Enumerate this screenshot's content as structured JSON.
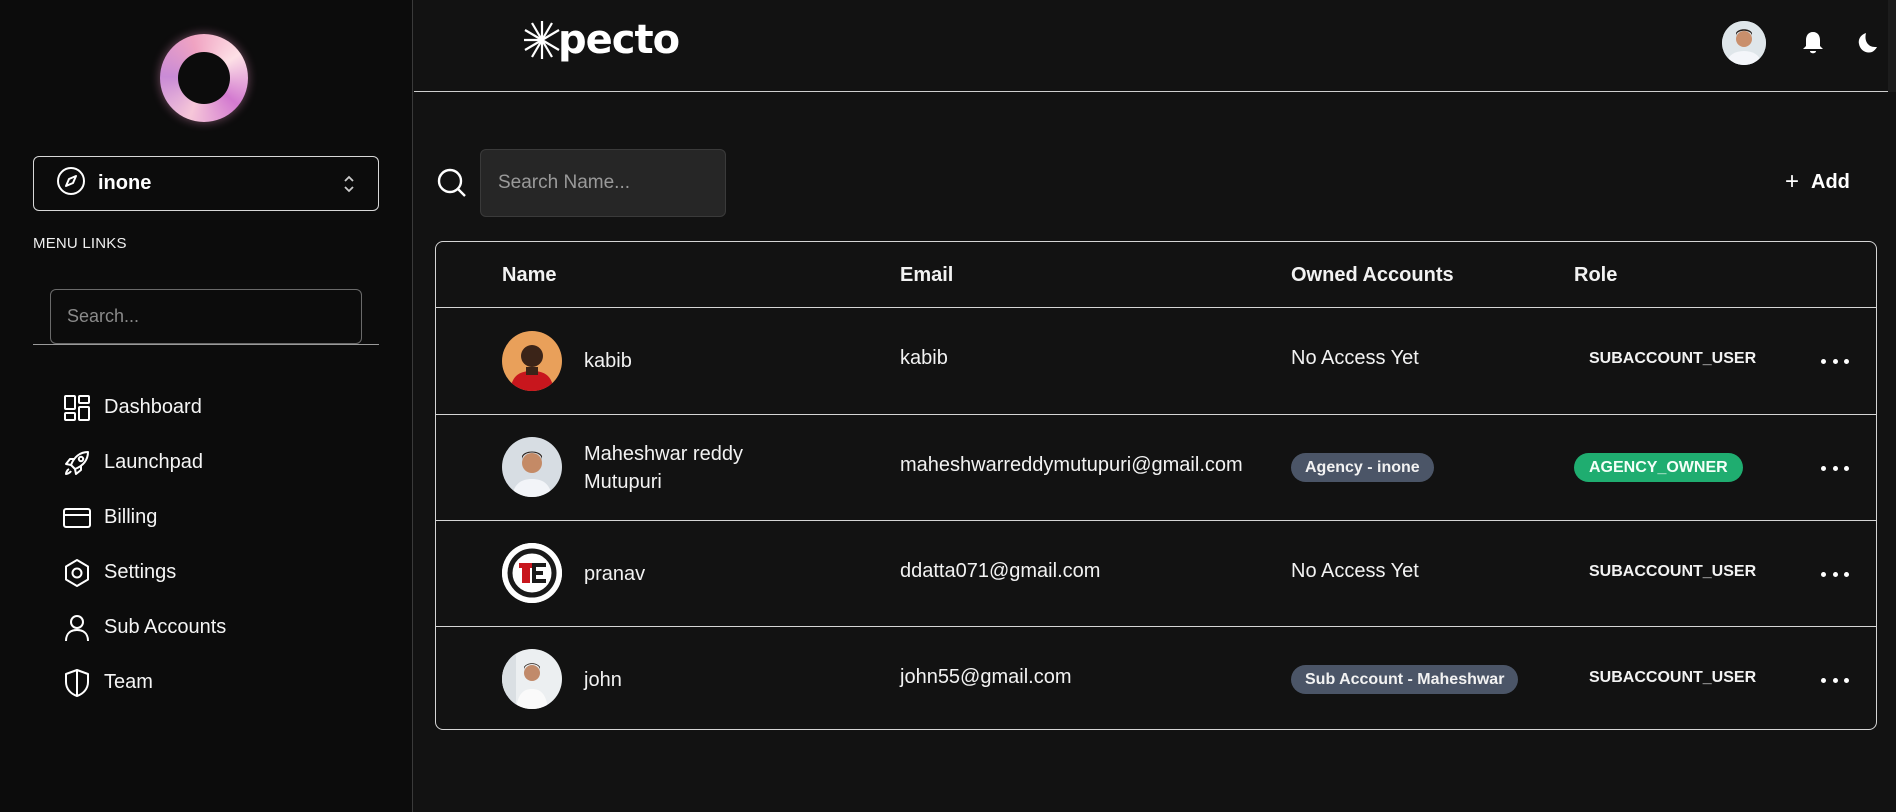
{
  "sidebar": {
    "account": {
      "name": "inone"
    },
    "menu_heading": "MENU LINKS",
    "search_placeholder": "Search...",
    "items": [
      {
        "label": "Dashboard",
        "icon": "dashboard-icon"
      },
      {
        "label": "Launchpad",
        "icon": "rocket-icon"
      },
      {
        "label": "Billing",
        "icon": "credit-card-icon"
      },
      {
        "label": "Settings",
        "icon": "settings-icon"
      },
      {
        "label": "Sub Accounts",
        "icon": "user-icon"
      },
      {
        "label": "Team",
        "icon": "shield-icon"
      }
    ]
  },
  "header": {
    "brand": "pecto",
    "icons": [
      "user-avatar",
      "bell-icon",
      "moon-icon"
    ]
  },
  "main": {
    "search_placeholder": "Search Name...",
    "add_label": "Add",
    "table": {
      "columns": [
        "Name",
        "Email",
        "Owned Accounts",
        "Role"
      ],
      "rows": [
        {
          "name": "kabib",
          "email": "kabib",
          "owned": "No Access Yet",
          "owned_is_badge": false,
          "role": "SUBACCOUNT_USER",
          "role_is_badge": false
        },
        {
          "name": "Maheshwar reddy Mutupuri",
          "email": "maheshwarreddymutupuri@gmail.com",
          "owned": "Agency - inone",
          "owned_is_badge": true,
          "role": "AGENCY_OWNER",
          "role_is_badge": true
        },
        {
          "name": "pranav",
          "email": "ddatta071@gmail.com",
          "owned": "No Access Yet",
          "owned_is_badge": false,
          "role": "SUBACCOUNT_USER",
          "role_is_badge": false
        },
        {
          "name": "john",
          "email": "john55@gmail.com",
          "owned": "Sub Account - Maheshwar",
          "owned_is_badge": true,
          "role": "SUBACCOUNT_USER",
          "role_is_badge": false
        }
      ]
    }
  },
  "colors": {
    "background": "#121212",
    "sidebar": "#0c0c0c",
    "badge_gray": "#4b5567",
    "badge_green": "#1fad70"
  }
}
